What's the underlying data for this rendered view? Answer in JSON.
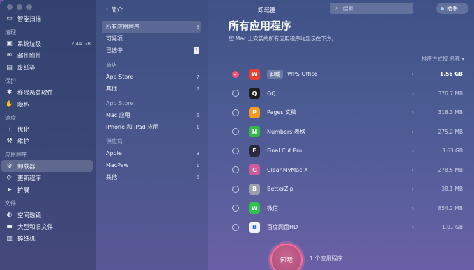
{
  "sidebar": {
    "top_item": {
      "label": "智能扫描",
      "icon": "monitor-icon"
    },
    "sections": [
      {
        "title": "清理",
        "items": [
          {
            "label": "系统垃圾",
            "icon": "trash-icon",
            "size": "2.44 GB"
          },
          {
            "label": "邮件附件",
            "icon": "mail-icon"
          },
          {
            "label": "废纸篓",
            "icon": "bin-icon"
          }
        ]
      },
      {
        "title": "保护",
        "items": [
          {
            "label": "移除恶意软件",
            "icon": "bug-icon"
          },
          {
            "label": "隐私",
            "icon": "hand-icon"
          }
        ]
      },
      {
        "title": "速度",
        "items": [
          {
            "label": "优化",
            "icon": "sliders-icon"
          },
          {
            "label": "维护",
            "icon": "wrench-icon"
          }
        ]
      },
      {
        "title": "应用程序",
        "items": [
          {
            "label": "卸载器",
            "icon": "uninstaller-icon",
            "active": true
          },
          {
            "label": "更新程序",
            "icon": "update-icon"
          },
          {
            "label": "扩展",
            "icon": "extension-icon"
          }
        ]
      },
      {
        "title": "文件",
        "items": [
          {
            "label": "空间透镜",
            "icon": "lens-icon"
          },
          {
            "label": "大型和旧文件",
            "icon": "folder-icon"
          },
          {
            "label": "碎纸机",
            "icon": "shredder-icon"
          }
        ]
      }
    ]
  },
  "middle": {
    "back_label": "简介",
    "items": [
      {
        "label": "所有应用程序",
        "count": "9",
        "active": true
      },
      {
        "label": "可疑项",
        "count": ""
      },
      {
        "label": "已选中",
        "count": "1",
        "badge": true
      }
    ],
    "groups": [
      {
        "title": "商店",
        "items": [
          {
            "label": "App Store",
            "count": "7"
          },
          {
            "label": "其他",
            "count": "2"
          }
        ]
      },
      {
        "title": "App Store",
        "items": [
          {
            "label": "Mac 应用",
            "count": "6"
          },
          {
            "label": "iPhone 和 iPad 应用",
            "count": "1"
          }
        ]
      },
      {
        "title": "供应商",
        "items": [
          {
            "label": "Apple",
            "count": "3"
          },
          {
            "label": "MacPaw",
            "count": "1"
          },
          {
            "label": "其他",
            "count": "5"
          }
        ]
      }
    ]
  },
  "main": {
    "topbar_title": "卸载器",
    "search_placeholder": "搜索",
    "assistant_label": "助手",
    "title": "所有应用程序",
    "subtitle": "您 Mac 上安装的所有应用程序均显示在下方。",
    "sort_label": "排序方式按 名称",
    "action_chip": "卸载",
    "apps": [
      {
        "name": "WPS Office",
        "size": "1.56 GB",
        "checked": true,
        "color": "#e8412f",
        "glyph": "W"
      },
      {
        "name": "QQ",
        "size": "376.7 MB",
        "checked": false,
        "color": "#1d1d1d",
        "glyph": "Q"
      },
      {
        "name": "Pages 文稿",
        "size": "318.3 MB",
        "checked": false,
        "color": "#f39a1f",
        "glyph": "P"
      },
      {
        "name": "Numbers 表格",
        "size": "275.2 MB",
        "checked": false,
        "color": "#34b64a",
        "glyph": "N"
      },
      {
        "name": "Final Cut Pro",
        "size": "3.63 GB",
        "checked": false,
        "color": "#2a2a3a",
        "glyph": "F"
      },
      {
        "name": "CleanMyMac X",
        "size": "278.5 MB",
        "checked": false,
        "color": "#d15a9b",
        "glyph": "C"
      },
      {
        "name": "BetterZip",
        "size": "38.1 MB",
        "checked": false,
        "color": "#9aa1ad",
        "glyph": "B"
      },
      {
        "name": "微信",
        "size": "854.2 MB",
        "checked": false,
        "color": "#2dc14e",
        "glyph": "W"
      },
      {
        "name": "百度网盘HD",
        "size": "1.01 GB",
        "checked": false,
        "color": "#f3f4f8",
        "glyph": "B"
      }
    ],
    "uninstall_button": "卸载",
    "selected_summary": "1 个应用程序"
  }
}
